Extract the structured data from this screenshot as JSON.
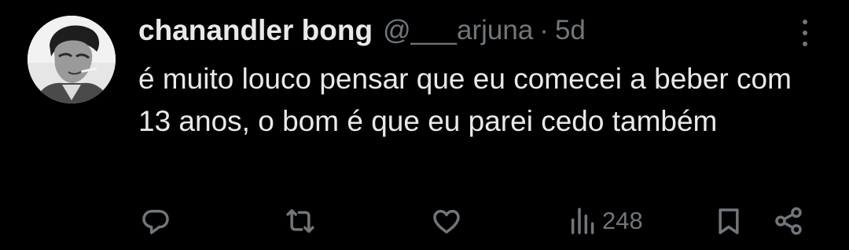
{
  "tweet": {
    "display_name": "chanandler bong",
    "handle": "@___arjuna",
    "separator": "·",
    "time": "5d",
    "text": "é muito louco pensar que eu comecei a beber com 13 anos, o bom é que eu parei cedo também",
    "avatar_icon": "profile-photo",
    "more_icon": "more-vertical-icon"
  },
  "actions": {
    "reply_icon": "reply-icon",
    "retweet_icon": "retweet-icon",
    "like_icon": "like-icon",
    "views_icon": "views-icon",
    "views_count": "248",
    "bookmark_icon": "bookmark-icon",
    "share_icon": "share-icon"
  },
  "colors": {
    "background": "#000000",
    "primary_text": "#e7e9ea",
    "secondary_text": "#71767b"
  }
}
